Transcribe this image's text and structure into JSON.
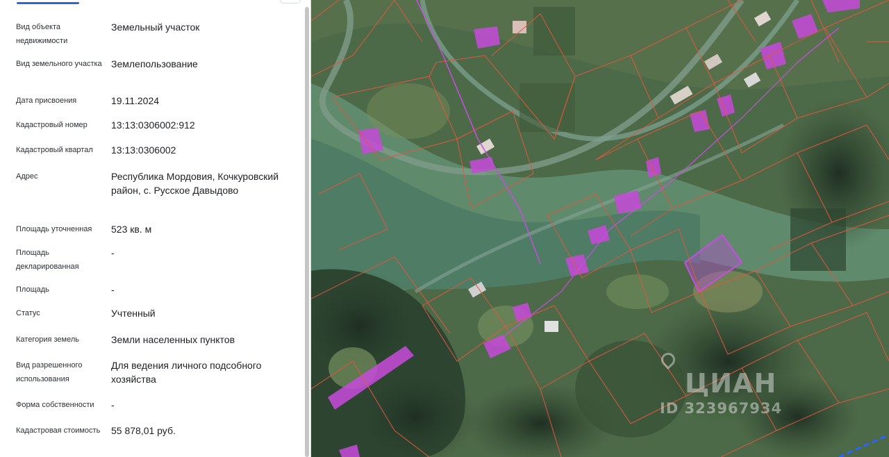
{
  "properties": [
    {
      "key": "Вид объекта недвижимости",
      "value": "Земельный участок"
    },
    {
      "key": "Вид земельного участка",
      "value": "Землепользование"
    },
    {
      "key": "Дата присвоения",
      "value": "19.11.2024"
    },
    {
      "key": "Кадастровый номер",
      "value": "13:13:0306002:912"
    },
    {
      "key": "Кадастровый квартал",
      "value": "13:13:0306002"
    },
    {
      "key": "Адрес",
      "value": "Республика Мордовия, Кочкуровский район, с. Русское Давыдово"
    },
    {
      "key": "Площадь уточненная",
      "value": "523 кв. м"
    },
    {
      "key": "Площадь декларированная",
      "value": "-"
    },
    {
      "key": "Площадь",
      "value": "-"
    },
    {
      "key": "Статус",
      "value": "Учтенный"
    },
    {
      "key": "Категория земель",
      "value": "Земли населенных пунктов"
    },
    {
      "key": "Вид разрешенного использования",
      "value": "Для ведения личного подсобного хозяйства"
    },
    {
      "key": "Форма собственности",
      "value": "-"
    },
    {
      "key": "Кадастровая стоимость",
      "value": "55 878,01 руб."
    }
  ],
  "map": {
    "watermark_logo": "ЦИАН",
    "watermark_id": "ID 323967934",
    "parcel_line_color": "#e0573e",
    "building_color": "#c44bd6",
    "selected_parcel_color": "#b44fcf"
  }
}
